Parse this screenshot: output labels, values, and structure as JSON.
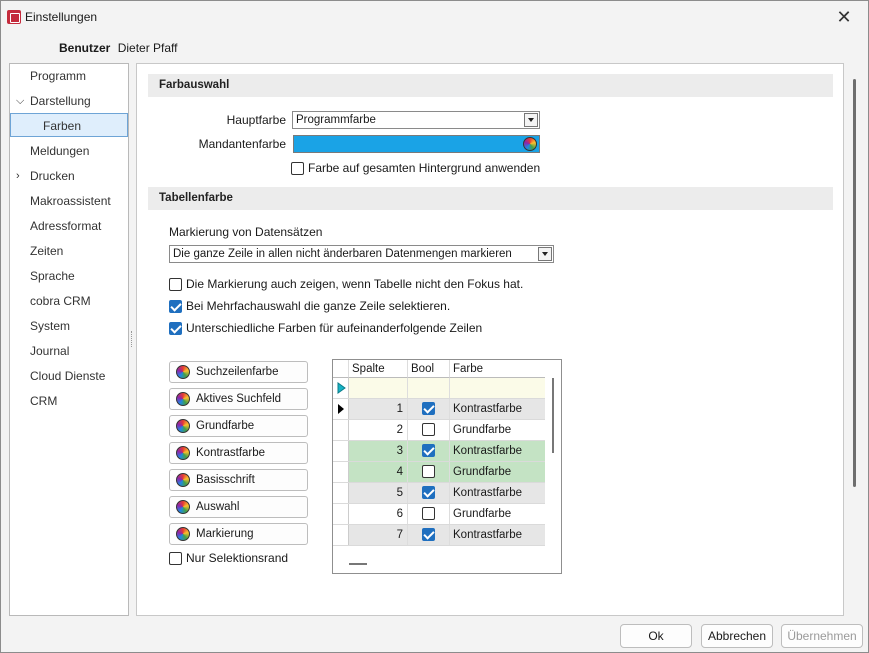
{
  "window": {
    "title": "Einstellungen"
  },
  "user": {
    "label": "Benutzer",
    "name": "Dieter Pfaff"
  },
  "sidebar": {
    "items": [
      {
        "label": "Programm"
      },
      {
        "label": "Darstellung",
        "expanded": true
      },
      {
        "label": "Farben",
        "selected": true
      },
      {
        "label": "Meldungen"
      },
      {
        "label": "Drucken",
        "expanded": false
      },
      {
        "label": "Makroassistent"
      },
      {
        "label": "Adressformat"
      },
      {
        "label": "Zeiten"
      },
      {
        "label": "Sprache"
      },
      {
        "label": "cobra CRM"
      },
      {
        "label": "System"
      },
      {
        "label": "Journal"
      },
      {
        "label": "Cloud Dienste"
      },
      {
        "label": "CRM"
      }
    ]
  },
  "farbauswahl": {
    "header": "Farbauswahl",
    "hauptfarbe_label": "Hauptfarbe",
    "hauptfarbe_value": "Programmfarbe",
    "mandantenfarbe_label": "Mandantenfarbe",
    "mandantenfarbe_color": "#1aa3e6",
    "hintergrund_label": "Farbe auf gesamten Hintergrund anwenden",
    "hintergrund_checked": false
  },
  "tabellenfarbe": {
    "header": "Tabellenfarbe",
    "markierung_label": "Markierung von Datensätzen",
    "markierung_value": "Die ganze Zeile in allen nicht änderbaren Datenmengen markieren",
    "options": [
      {
        "label": "Die Markierung auch zeigen, wenn Tabelle nicht den Fokus hat.",
        "checked": false
      },
      {
        "label": "Bei Mehrfachauswahl die ganze Zeile selektieren.",
        "checked": true
      },
      {
        "label": "Unterschiedliche Farben für aufeinanderfolgende Zeilen",
        "checked": true
      }
    ],
    "buttons": [
      {
        "label": "Suchzeilenfarbe"
      },
      {
        "label": "Aktives Suchfeld"
      },
      {
        "label": "Grundfarbe"
      },
      {
        "label": "Kontrastfarbe"
      },
      {
        "label": "Basisschrift"
      },
      {
        "label": "Auswahl"
      },
      {
        "label": "Markierung"
      }
    ],
    "nur_selektionsrand_label": "Nur Selektionsrand",
    "nur_selektionsrand_checked": false
  },
  "grid": {
    "columns": [
      "Spalte",
      "Bool",
      "Farbe"
    ],
    "rows": [
      {
        "spalte": "",
        "bool": null,
        "farbe": ""
      },
      {
        "spalte": "1",
        "bool": true,
        "farbe": "Kontrastfarbe"
      },
      {
        "spalte": "2",
        "bool": false,
        "farbe": "Grundfarbe"
      },
      {
        "spalte": "3",
        "bool": true,
        "farbe": "Kontrastfarbe"
      },
      {
        "spalte": "4",
        "bool": false,
        "farbe": "Grundfarbe"
      },
      {
        "spalte": "5",
        "bool": true,
        "farbe": "Kontrastfarbe"
      },
      {
        "spalte": "6",
        "bool": false,
        "farbe": "Grundfarbe"
      },
      {
        "spalte": "7",
        "bool": true,
        "farbe": "Kontrastfarbe"
      }
    ],
    "colors": {
      "search_row": "#fbfbe8",
      "contrast": "#e6e6e6",
      "base": "#ffffff",
      "selection": "#c4e3c4"
    }
  },
  "footer": {
    "ok": "Ok",
    "cancel": "Abbrechen",
    "apply": "Übernehmen"
  }
}
